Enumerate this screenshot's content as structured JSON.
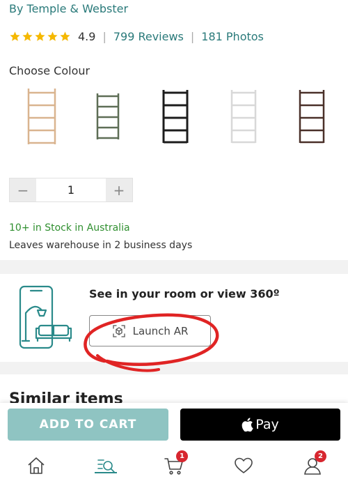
{
  "product": {
    "brand": "By Temple & Webster",
    "rating": "4.9",
    "rating_stars": 5,
    "reviews_link": "799 Reviews",
    "photos_link": "181 Photos"
  },
  "colour": {
    "title": "Choose Colour",
    "swatches": [
      {
        "name": "natural",
        "hex": "#d9b48f"
      },
      {
        "name": "olive",
        "hex": "#5e6e56"
      },
      {
        "name": "black",
        "hex": "#1c1c1c"
      },
      {
        "name": "white",
        "hex": "#e4e4e4"
      },
      {
        "name": "walnut",
        "hex": "#4a3029"
      }
    ]
  },
  "quantity": {
    "minus": "−",
    "value": "1",
    "plus": "+"
  },
  "stock": {
    "status": "10+ in Stock in Australia",
    "shipping": "Leaves warehouse in 2 business days"
  },
  "ar": {
    "title": "See in your room or view 360º",
    "button_label": "Launch AR"
  },
  "similar": {
    "title": "Similar items"
  },
  "cta": {
    "add_to_cart": "ADD TO CART",
    "apple_pay": "Pay"
  },
  "nav": {
    "cart_badge": "1",
    "account_badge": "2"
  },
  "colors": {
    "accent": "#2a7a7a",
    "star": "#f5b800",
    "stock_green": "#2f8f2f",
    "add_to_cart": "#8fc4c2",
    "badge_red": "#d7262f",
    "annotation_red": "#e02424"
  }
}
